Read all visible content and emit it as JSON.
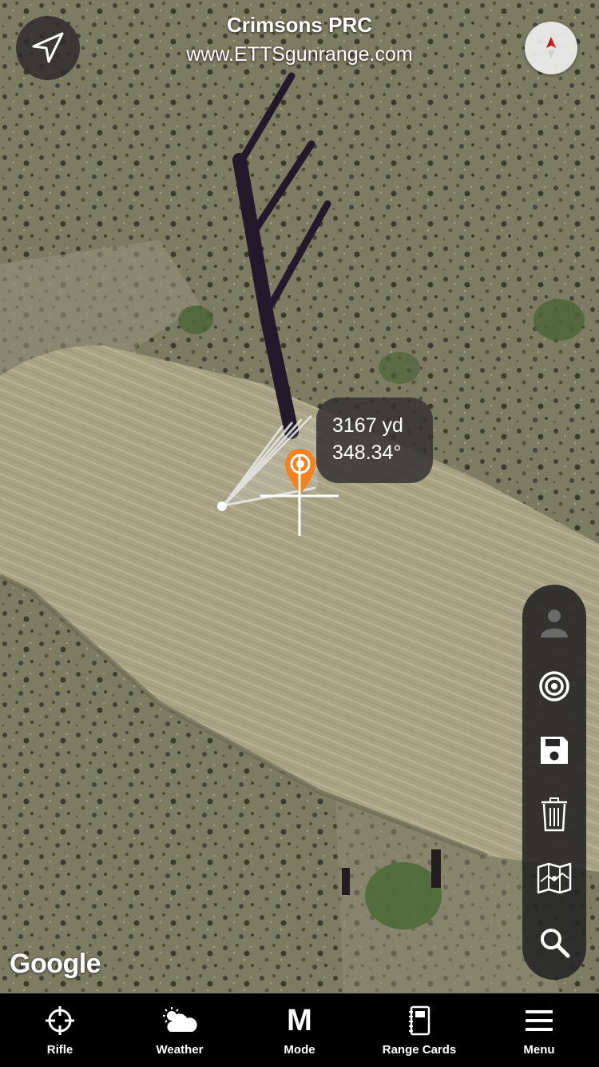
{
  "header": {
    "title": "Crimsons PRC",
    "url": "www.ETTSgunrange.com",
    "locate_icon": "location-arrow-icon",
    "compass_icon": "compass-icon"
  },
  "readout": {
    "distance": "3167 yd",
    "bearing": "348.34°"
  },
  "map": {
    "attribution": "Google",
    "pin_color": "#f5821f"
  },
  "toolbar": {
    "items": [
      {
        "name": "person-icon"
      },
      {
        "name": "target-icon"
      },
      {
        "name": "save-icon"
      },
      {
        "name": "trash-icon"
      },
      {
        "name": "map-icon"
      },
      {
        "name": "search-icon"
      }
    ]
  },
  "tabbar": {
    "tabs": [
      {
        "label": "Rifle",
        "icon": "crosshair-icon"
      },
      {
        "label": "Weather",
        "icon": "weather-icon"
      },
      {
        "label": "Mode",
        "icon_text": "M"
      },
      {
        "label": "Range Cards",
        "icon": "notebook-icon"
      },
      {
        "label": "Menu",
        "icon": "menu-icon"
      }
    ]
  }
}
